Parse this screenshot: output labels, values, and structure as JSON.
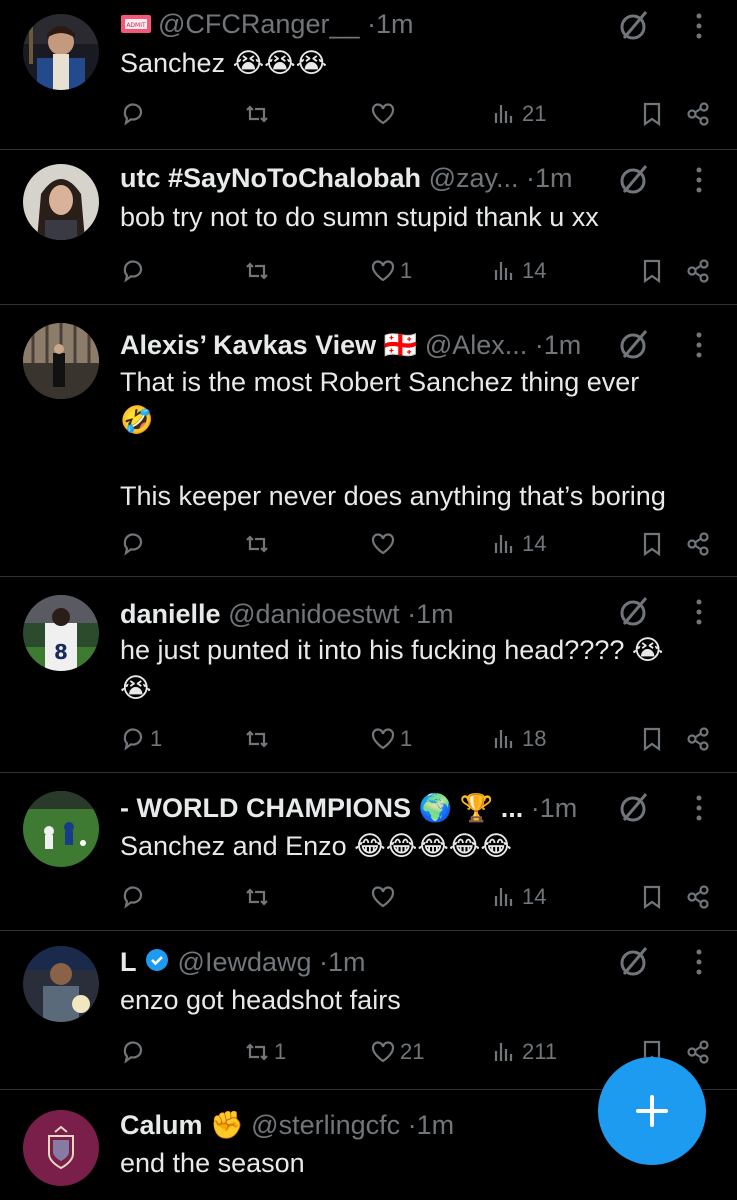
{
  "tweets": [
    {
      "name": "",
      "badge_icon": "ticket-icon",
      "handle": "@CFCRanger__",
      "dot": "·",
      "time": "1m",
      "text": "Sanchez 😭😭😭",
      "reply_count": "",
      "retweet_count": "",
      "like_count": "",
      "views": "21",
      "avatar_color": "#2b4a7a"
    },
    {
      "name": "utc #SayNoToChalobah",
      "handle": "@zay...",
      "dot": "·",
      "time": "1m",
      "text": "bob try not to do sumn stupid thank u xx",
      "reply_count": "",
      "retweet_count": "",
      "like_count": "1",
      "views": "14",
      "avatar_color": "#8a7a70"
    },
    {
      "name": "Alexis’ Kavkas View 🇬🇪",
      "handle": "@Alex...",
      "dot": "·",
      "time": "1m",
      "text": "That is the most Robert Sanchez thing ever\n🤣\n\nThis keeper never does anything that’s boring",
      "reply_count": "",
      "retweet_count": "",
      "like_count": "",
      "views": "14",
      "avatar_color": "#5a5048"
    },
    {
      "name": "danielle",
      "handle": "@danidoestwt",
      "dot": "·",
      "time": "1m",
      "text": "he just punted it into his fucking head???? 😭\n😭",
      "reply_count": "1",
      "retweet_count": "",
      "like_count": "1",
      "views": "18",
      "avatar_color": "#3f6a3a"
    },
    {
      "name": "- WORLD CHAMPIONS 🌍 🏆 ...",
      "handle": "",
      "dot": "·",
      "time": "1m",
      "text": "Sanchez and Enzo 😂😂😂😂😂",
      "reply_count": "",
      "retweet_count": "",
      "like_count": "",
      "views": "14",
      "avatar_color": "#3e7a32"
    },
    {
      "name": "L",
      "verified_icon": "verified-badge-icon",
      "handle": "@Iewdawg",
      "dot": "·",
      "time": "1m",
      "text": "enzo got headshot fairs",
      "reply_count": "",
      "retweet_count": "1",
      "like_count": "21",
      "views": "211",
      "avatar_color": "#3a3d48"
    },
    {
      "name": "Calum ✊",
      "handle": "@sterlingcfc",
      "dot": "·",
      "time": "1m",
      "text": "end the season",
      "avatar_color": "#7a1f4a"
    }
  ],
  "fab": {
    "icon": "plus-icon",
    "color": "#1d9bf0"
  }
}
